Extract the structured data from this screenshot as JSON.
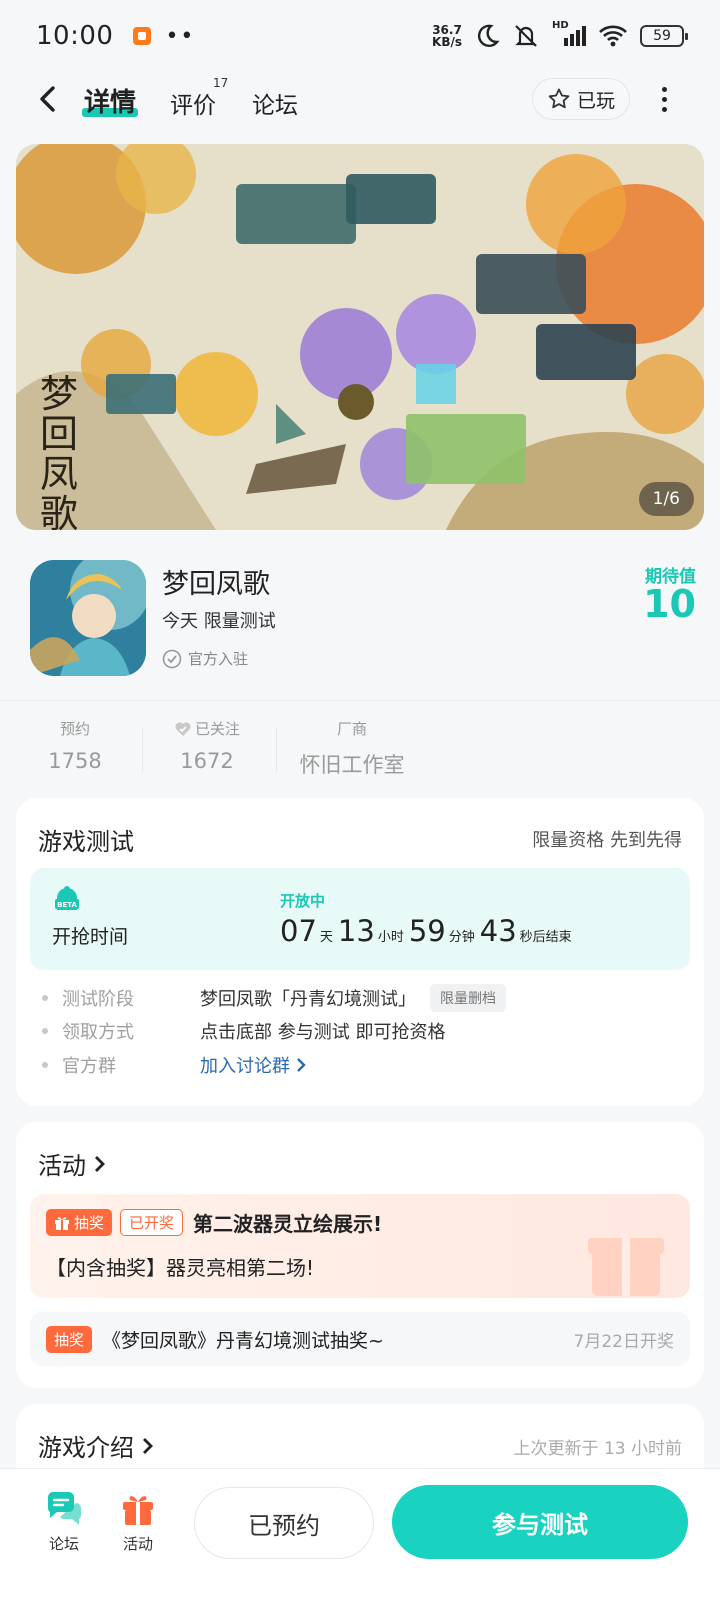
{
  "status_bar": {
    "time": "10:00",
    "dots": "••",
    "net_speed_value": "36.7",
    "net_speed_unit": "KB/s",
    "network_label": "HD",
    "battery": "59"
  },
  "nav": {
    "tabs": [
      {
        "label": "详情",
        "active": true
      },
      {
        "label": "评价",
        "badge": "17"
      },
      {
        "label": "论坛"
      }
    ],
    "played_label": "已玩"
  },
  "banner": {
    "counter": "1/6",
    "logo_text": "梦回凤歌"
  },
  "game": {
    "title": "梦回凤歌",
    "subtitle": "今天 限量测试",
    "official": "官方入驻",
    "expect_label": "期待值",
    "expect_value": "10"
  },
  "stats": [
    {
      "label": "预约",
      "value": "1758"
    },
    {
      "label": "已关注",
      "value": "1672"
    },
    {
      "label": "厂商",
      "value": "怀旧工作室"
    }
  ],
  "test_card": {
    "title": "游戏测试",
    "right_text": "限量资格 先到先得",
    "timer": {
      "label": "开抢时间",
      "status": "开放中",
      "days": "07",
      "days_unit": "天",
      "hours": "13",
      "hours_unit": "小时",
      "minutes": "59",
      "minutes_unit": "分钟",
      "seconds": "43",
      "seconds_unit": "秒后结束"
    },
    "rows": [
      {
        "key": "测试阶段",
        "value": "梦回凤歌「丹青幻境测试」",
        "tag": "限量删档"
      },
      {
        "key": "领取方式",
        "value": "点击底部 参与测试 即可抢资格"
      },
      {
        "key": "官方群",
        "value": "加入讨论群"
      }
    ]
  },
  "activity_card": {
    "title": "活动",
    "promo": {
      "tag": "抽奖",
      "status_tag": "已开奖",
      "title": "第二波器灵立绘展示!",
      "desc": "【内含抽奖】器灵亮相第二场!"
    },
    "draw": {
      "tag": "抽奖",
      "text": "《梦回凤歌》丹青幻境测试抽奖~",
      "date": "7月22日开奖"
    }
  },
  "intro_card": {
    "title": "游戏介绍",
    "updated": "上次更新于 13 小时前"
  },
  "bottom_bar": {
    "forum_label": "论坛",
    "activity_label": "活动",
    "reserved_label": "已预约",
    "join_label": "参与测试"
  },
  "colors": {
    "accent": "#19c9b5",
    "orange": "#ff6a3d",
    "link": "#2a6bb0"
  }
}
